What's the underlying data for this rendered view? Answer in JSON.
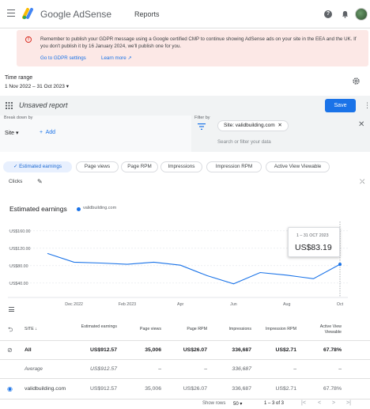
{
  "app": {
    "brand_google": "Google",
    "brand_product": "AdSense",
    "page_title": "Reports"
  },
  "banner": {
    "text": "Remember to publish your GDPR message using a Google certified CMP to continue showing AdSense ads on your site in the EEA and the UK. If you don't publish it by 16 January 2024, we'll publish one for you.",
    "link1": "Go to GDPR settings",
    "link2": "Learn more"
  },
  "time_range": {
    "label": "Time range",
    "value": "1 Nov 2022 – 31 Oct 2023"
  },
  "toolbar": {
    "report_name": "Unsaved report",
    "save_label": "Save"
  },
  "breakdown": {
    "label": "Break down by",
    "dimension": "Site",
    "add_label": "Add"
  },
  "filter": {
    "label": "Filter by",
    "chip": "Site: validbuilding.com",
    "placeholder": "Search or filter your data"
  },
  "metrics": [
    "Estimated earnings",
    "Page views",
    "Page RPM",
    "Impressions",
    "Impression RPM",
    "Active View Viewable",
    "Clicks"
  ],
  "chart": {
    "title": "Estimated earnings",
    "legend": "validbuilding.com",
    "tooltip_date": "1 – 31 OCT 2023",
    "tooltip_value": "US$83.19"
  },
  "chart_data": {
    "type": "line",
    "x": [
      "Nov 2022",
      "Dec 2022",
      "Jan 2023",
      "Feb 2023",
      "Mar 2023",
      "Apr 2023",
      "May 2023",
      "Jun 2023",
      "Jul 2023",
      "Aug 2023",
      "Sep 2023",
      "Oct 2023"
    ],
    "series": [
      {
        "name": "validbuilding.com",
        "values": [
          108,
          88,
          86,
          83,
          88,
          81,
          57,
          38,
          64,
          58,
          50,
          83
        ]
      }
    ],
    "yticks": [
      "US$160.00",
      "US$120.00",
      "US$80.00",
      "US$40.00"
    ],
    "ytick_values": [
      160,
      120,
      80,
      40
    ],
    "xticks": [
      "Dec 2022",
      "Feb 2023",
      "Apr",
      "Jun",
      "Aug",
      "Oct"
    ],
    "ylim": [
      25,
      165
    ],
    "color": "#1a73e8"
  },
  "table": {
    "headers": {
      "site": "SITE",
      "earnings": "Estimated earnings",
      "page_views": "Page views",
      "page_rpm": "Page RPM",
      "impressions": "Impressions",
      "impression_rpm": "Impression RPM",
      "active_view": "Active View Viewable"
    },
    "rows": [
      {
        "site": "All",
        "earnings": "US$912.57",
        "page_views": "35,006",
        "page_rpm": "US$26.07",
        "impressions": "336,687",
        "impression_rpm": "US$2.71",
        "active_view": "67.78%"
      },
      {
        "site": "Average",
        "earnings": "US$912.57",
        "page_views": "–",
        "page_rpm": "–",
        "impressions": "336,687",
        "impression_rpm": "–",
        "active_view": "–"
      },
      {
        "site": "validbuilding.com",
        "earnings": "US$912.57",
        "page_views": "35,006",
        "page_rpm": "US$26.07",
        "impressions": "336,687",
        "impression_rpm": "US$2.71",
        "active_view": "67.78%"
      }
    ]
  },
  "footer": {
    "show_rows_label": "Show rows",
    "rows_value": "50",
    "range": "1 – 3 of 3"
  }
}
